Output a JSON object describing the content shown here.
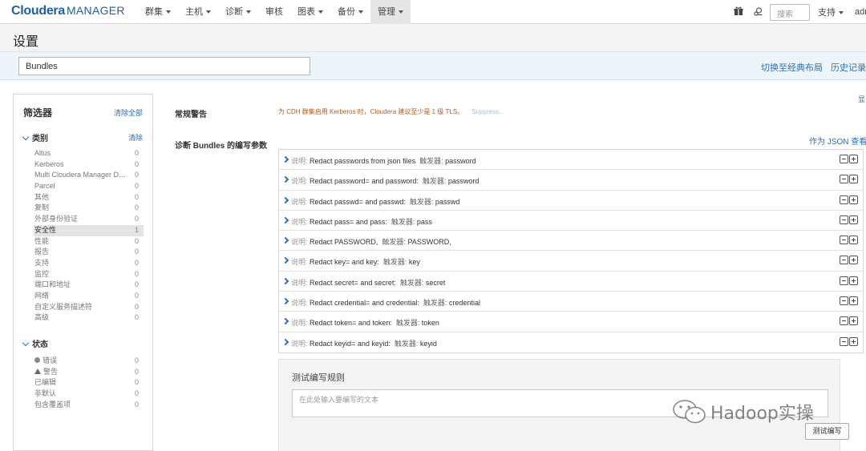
{
  "brand": {
    "name": "Cloudera",
    "product": "MANAGER"
  },
  "nav": [
    {
      "label": "群集",
      "dropdown": true,
      "active": false
    },
    {
      "label": "主机",
      "dropdown": true,
      "active": false
    },
    {
      "label": "诊断",
      "dropdown": true,
      "active": false
    },
    {
      "label": "审核",
      "dropdown": false,
      "active": false
    },
    {
      "label": "图表",
      "dropdown": true,
      "active": false
    },
    {
      "label": "备份",
      "dropdown": true,
      "active": false
    },
    {
      "label": "管理",
      "dropdown": true,
      "active": true
    }
  ],
  "nav_right": {
    "search_placeholder": "搜索",
    "support": "支持",
    "user": "adr"
  },
  "page_title": "设置",
  "search_value": "Bundles",
  "links": {
    "classic_layout": "切换至经典布局",
    "history": "历史记录和"
  },
  "sidebar": {
    "title": "筛选器",
    "clear_all": "清除全部",
    "category": {
      "title": "类别",
      "clear": "清除",
      "items": [
        {
          "label": "Altus",
          "count": "0"
        },
        {
          "label": "Kerberos",
          "count": "0"
        },
        {
          "label": "Multi Cloudera Manager Das...",
          "count": "0"
        },
        {
          "label": "Parcel",
          "count": "0"
        },
        {
          "label": "其他",
          "count": "0"
        },
        {
          "label": "复制",
          "count": "0"
        },
        {
          "label": "外部身份验证",
          "count": "0"
        },
        {
          "label": "安全性",
          "count": "1",
          "selected": true
        },
        {
          "label": "性能",
          "count": "0"
        },
        {
          "label": "报告",
          "count": "0"
        },
        {
          "label": "支持",
          "count": "0"
        },
        {
          "label": "监控",
          "count": "0"
        },
        {
          "label": "端口和地址",
          "count": "0"
        },
        {
          "label": "网络",
          "count": "0"
        },
        {
          "label": "自定义服务描述符",
          "count": "0"
        },
        {
          "label": "高级",
          "count": "0"
        }
      ]
    },
    "status": {
      "title": "状态",
      "items": [
        {
          "label": "错误",
          "count": "0",
          "icon": "error-icon"
        },
        {
          "label": "警告",
          "count": "0",
          "icon": "warning-icon"
        },
        {
          "label": "已编辑",
          "count": "0"
        },
        {
          "label": "非默认",
          "count": "0"
        },
        {
          "label": "包含覆盖项",
          "count": "0"
        }
      ]
    }
  },
  "main": {
    "general_warning_label": "常规警告",
    "general_warning_text": "为 CDH 群集启用 Kerberos 时，Cloudera 建议至少是 1 级 TLS。",
    "suppress": "Suppress...",
    "far_right": "显",
    "param_label": "诊断 Bundles 的编写参数",
    "json_link": "作为 JSON 查看",
    "rules": [
      {
        "desc": "Redact passwords from json files",
        "trigger": "password"
      },
      {
        "desc": "Redact password= and password:",
        "trigger": "password"
      },
      {
        "desc": "Redact passwd= and passwd:",
        "trigger": "passwd"
      },
      {
        "desc": "Redact pass= and pass:",
        "trigger": "pass"
      },
      {
        "desc": "Redact PASSWORD,",
        "trigger": "PASSWORD,"
      },
      {
        "desc": "Redact key= and key:",
        "trigger": "key"
      },
      {
        "desc": "Redact secret= and secret:",
        "trigger": "secret"
      },
      {
        "desc": "Redact credential= and credential:",
        "trigger": "credential"
      },
      {
        "desc": "Redact token= and token:",
        "trigger": "token"
      },
      {
        "desc": "Redact keyid= and keyid:",
        "trigger": "keyid"
      }
    ],
    "desc_key": "说明:",
    "trigger_key": "触发器:",
    "test_title": "测试编写规则",
    "test_placeholder": "在此处输入要编写的文本",
    "test_button": "测试编写"
  },
  "watermark": "Hadoop实操",
  "colors": {
    "brand": "#1f5fa7",
    "link": "#2a6ebb",
    "warning": "#b35a1f"
  }
}
